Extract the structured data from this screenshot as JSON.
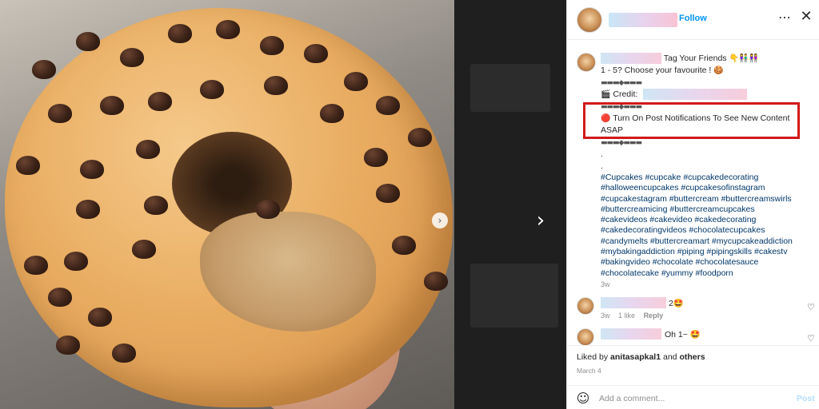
{
  "header": {
    "follow_label": "Follow",
    "more_glyph": "⋯",
    "close_glyph": "✕"
  },
  "caption": {
    "line1_text": "Tag Your Friends",
    "line1_emoji": "👇👫👭",
    "line2_text": "1 - 5? Choose your favourite !",
    "line2_emoji": "🍪",
    "divider": "▬▬▬◆▬▬▬",
    "credit_icon": "🎬",
    "credit_label": "Credit:",
    "notif_emoji": "🔴",
    "notif_text_1": "Turn On Post Notifications To See New Content",
    "notif_text_2": "ASAP",
    "dot": ".",
    "hashtag_lines": [
      "#Cupcakes #cupcake #cupcakedecorating",
      "#halloweencupcakes #cupcakesofinstagram",
      "#cupcakestagram #buttercream #buttercreamswirls",
      "#buttercreamicing #buttercreamcupcakes",
      "#cakevideos #cakevideo #cakedecorating",
      "#cakedecoratingvideos #chocolatecupcakes",
      "#candymelts #buttercreamart #mycupcakeaddiction",
      "#mybakingaddiction #piping #pipingskills #cakestv",
      "#bakingvideo #chocolate #chocolatesauce",
      "#chocolatecake #yummy #foodporn"
    ],
    "time": "3w"
  },
  "comments": [
    {
      "text": "2🤩",
      "time": "3w",
      "likes": "1 like",
      "reply": "Reply"
    },
    {
      "text": "Oh 1~ 🤩"
    }
  ],
  "footer": {
    "liked_prefix": "Liked by",
    "liked_user": "anitasapkal1",
    "liked_and": "and",
    "liked_others": "others",
    "date": "March 4",
    "comment_placeholder": "Add a comment...",
    "post_label": "Post",
    "smile_glyph": "☺",
    "heart_glyph": "♡"
  },
  "media": {
    "next_glyph": "›",
    "slide_glyph": "›"
  },
  "colors": {
    "link_blue": "#0095f6",
    "hashtag": "#00376b",
    "highlight": "#d11a1a"
  }
}
